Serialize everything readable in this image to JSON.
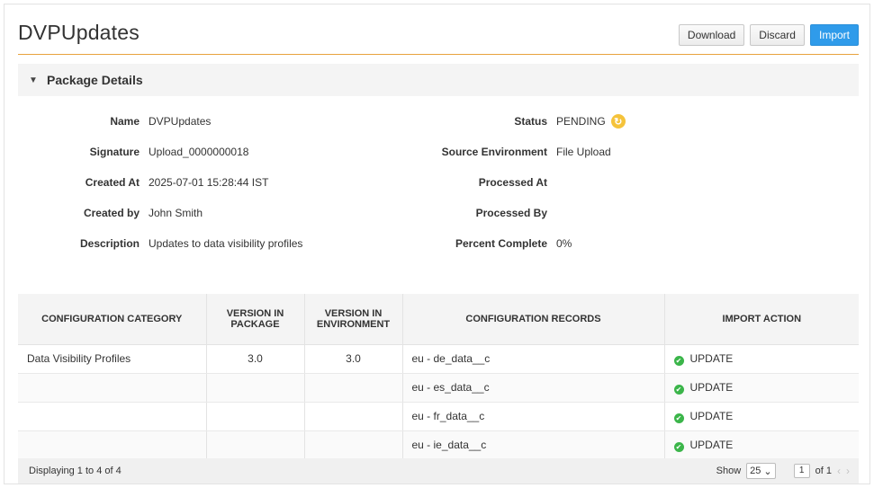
{
  "header": {
    "title": "DVPUpdates",
    "download_label": "Download",
    "discard_label": "Discard",
    "import_label": "Import"
  },
  "section": {
    "title": "Package Details",
    "caret_icon": "caret-down-icon"
  },
  "details": {
    "left": [
      {
        "label": "Name",
        "value": "DVPUpdates"
      },
      {
        "label": "Signature",
        "value": "Upload_0000000018"
      },
      {
        "label": "Created At",
        "value": "2025-07-01 15:28:44 IST"
      },
      {
        "label": "Created by",
        "value": "John Smith"
      },
      {
        "label": "Description",
        "value": "Updates to data visibility profiles"
      }
    ],
    "right": [
      {
        "label": "Status",
        "value": "PENDING"
      },
      {
        "label": "Source Environment",
        "value": "File Upload"
      },
      {
        "label": "Processed At",
        "value": ""
      },
      {
        "label": "Processed By",
        "value": ""
      },
      {
        "label": "Percent Complete",
        "value": "0%"
      }
    ],
    "status_icon": "pending-clock-icon",
    "status_color": "#f5c33b"
  },
  "table": {
    "columns": [
      {
        "label": "CONFIGURATION CATEGORY"
      },
      {
        "label": "VERSION IN PACKAGE"
      },
      {
        "label": "VERSION IN ENVIRONMENT"
      },
      {
        "label": "CONFIGURATION RECORDS"
      },
      {
        "label": "IMPORT ACTION"
      }
    ],
    "rows": [
      {
        "category": "Data Visibility Profiles",
        "version_package": "3.0",
        "version_env": "3.0",
        "record": "eu - de_data__c",
        "action": "UPDATE"
      },
      {
        "category": "",
        "version_package": "",
        "version_env": "",
        "record": "eu - es_data__c",
        "action": "UPDATE"
      },
      {
        "category": "",
        "version_package": "",
        "version_env": "",
        "record": "eu - fr_data__c",
        "action": "UPDATE"
      },
      {
        "category": "",
        "version_package": "",
        "version_env": "",
        "record": "eu - ie_data__c",
        "action": "UPDATE"
      }
    ],
    "action_icon_color": "#3bb54a"
  },
  "footer": {
    "displaying": "Displaying 1 to 4 of 4",
    "show_label": "Show",
    "page_size": "25",
    "page_number": "1",
    "page_of": "of 1"
  },
  "colors": {
    "accent_line": "#e8a33d",
    "primary_button": "#2f9bea"
  }
}
